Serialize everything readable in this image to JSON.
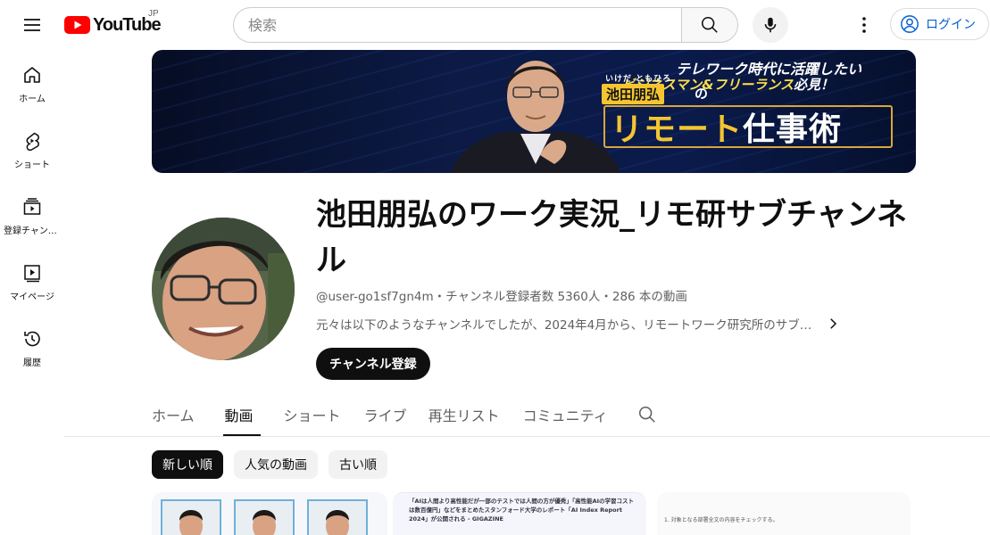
{
  "header": {
    "logo_text": "YouTube",
    "region": "JP",
    "search_placeholder": "検索",
    "login_label": "ログイン"
  },
  "sidebar": {
    "items": [
      {
        "label": "ホーム",
        "icon": "home-icon"
      },
      {
        "label": "ショート",
        "icon": "shorts-icon"
      },
      {
        "label": "登録チャンネル",
        "icon": "subscriptions-icon"
      },
      {
        "label": "マイページ",
        "icon": "library-icon"
      },
      {
        "label": "履歴",
        "icon": "history-icon"
      }
    ]
  },
  "banner": {
    "tagline": "テレワーク時代に活躍したい",
    "audience_highlight": "ビジネスマン&フリーランス",
    "audience_suffix": "必見！",
    "name_ruby": "いけだ ともひろ",
    "name": "池田朋弘",
    "particle": "の",
    "title_highlight": "リモート",
    "title_rest": "仕事術"
  },
  "channel": {
    "name": "池田朋弘のワーク実況_リモ研サブチャンネル",
    "meta": "@user-go1sf7gn4m・チャンネル登録者数 5360人・286 本の動画",
    "description": "元々は以下のようなチャンネルでしたが、2024年4月から、リモートワーク研究所のサブ…",
    "subscribe_label": "チャンネル登録"
  },
  "tabs": [
    {
      "label": "ホーム",
      "active": false
    },
    {
      "label": "動画",
      "active": true
    },
    {
      "label": "ショート",
      "active": false
    },
    {
      "label": "ライブ",
      "active": false
    },
    {
      "label": "再生リスト",
      "active": false
    },
    {
      "label": "コミュニティ",
      "active": false
    }
  ],
  "chips": [
    {
      "label": "新しい順",
      "selected": true
    },
    {
      "label": "人気の動画",
      "selected": false
    },
    {
      "label": "古い順",
      "selected": false
    }
  ],
  "thumbnails": {
    "video2_text": "「AIは人間より高性能だが一部のテストでは人間の方が優秀」「高性能AIの学習コストは数百億円」などをまとめたスタンフォード大学のレポート「AI Index Report 2024」が公開される - GIGAZINE",
    "video3_text": "1. 対象となる部署全文の内容をチェックする。"
  },
  "colors": {
    "brand_red": "#ff0000",
    "link_blue": "#065fd4",
    "banner_yellow": "#f4c531"
  }
}
